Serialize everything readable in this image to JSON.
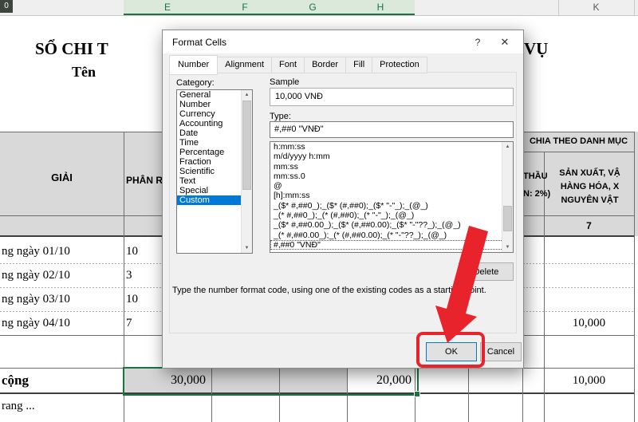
{
  "colors": {
    "accent_red": "#e8232b",
    "selection_blue": "#0078d7",
    "excel_green": "#1a7340"
  },
  "sheet": {
    "corner_label": "0",
    "column_letters": [
      "E",
      "F",
      "G",
      "H"
    ],
    "far_column_letter": "K",
    "title_left": "SỔ CHI T",
    "title_right": "VỤ",
    "subtitle": "Tên",
    "header": {
      "desc_col": "GIẢI",
      "mid_col": "PHÂN R",
      "group_title": "CHIA THEO DANH MỤC",
      "sub_left_lines": [
        "THẦU",
        "N: 2%)"
      ],
      "sub_right_lines": [
        "SẢN XUẤT, VẬ",
        "HÀNG HÓA, X",
        "NGUYÊN VẬT"
      ],
      "col_number": "7"
    },
    "rows": [
      {
        "date": "ng ngày 01/10",
        "value": "10",
        "right": ""
      },
      {
        "date": "ng ngày 02/10",
        "value": "3",
        "right": ""
      },
      {
        "date": "ng ngày 03/10",
        "value": "10",
        "right": ""
      },
      {
        "date": "ng ngày 04/10",
        "value": "7",
        "right": "10,000"
      }
    ],
    "total_row": {
      "label": "cộng",
      "value1": "30,000",
      "value2": "20,000",
      "right": "10,000"
    },
    "footer": "rang ..."
  },
  "dialog": {
    "title": "Format Cells",
    "icons": {
      "help": "?",
      "close": "✕",
      "scroll_up": "▲",
      "scroll_down": "▼"
    },
    "tabs": [
      "Number",
      "Alignment",
      "Font",
      "Border",
      "Fill",
      "Protection"
    ],
    "active_tab_index": 0,
    "category_label": "Category:",
    "category_list": {
      "items": [
        "General",
        "Number",
        "Currency",
        "Accounting",
        "Date",
        "Time",
        "Percentage",
        "Fraction",
        "Scientific",
        "Text",
        "Special",
        "Custom"
      ],
      "selected_index": 11
    },
    "sample_label": "Sample",
    "sample_value": "10,000 VNĐ",
    "type_label": "Type:",
    "type_value": "#,##0 \"VNĐ\"",
    "type_list": {
      "items": [
        "h:mm:ss",
        "m/d/yyyy h:mm",
        "mm:ss",
        "mm:ss.0",
        "@",
        "[h]:mm:ss",
        "_($* #,##0_);_($* (#,##0);_($* \"-\"_);_(@_)",
        "_(* #,##0_);_(* (#,##0);_(* \"-\"_);_(@_)",
        "_($* #,##0.00_);_($* (#,##0.00);_($* \"-\"??_);_(@_)",
        "_(* #,##0.00_);_(* (#,##0.00);_(* \"-\"??_);_(@_)",
        "#,##0 \"VNĐ\""
      ],
      "selected_index": 10
    },
    "delete_button": "Delete",
    "help_text": "Type the number format code, using one of the existing codes as a starting point.",
    "ok_button": "OK",
    "cancel_button": "Cancel"
  }
}
